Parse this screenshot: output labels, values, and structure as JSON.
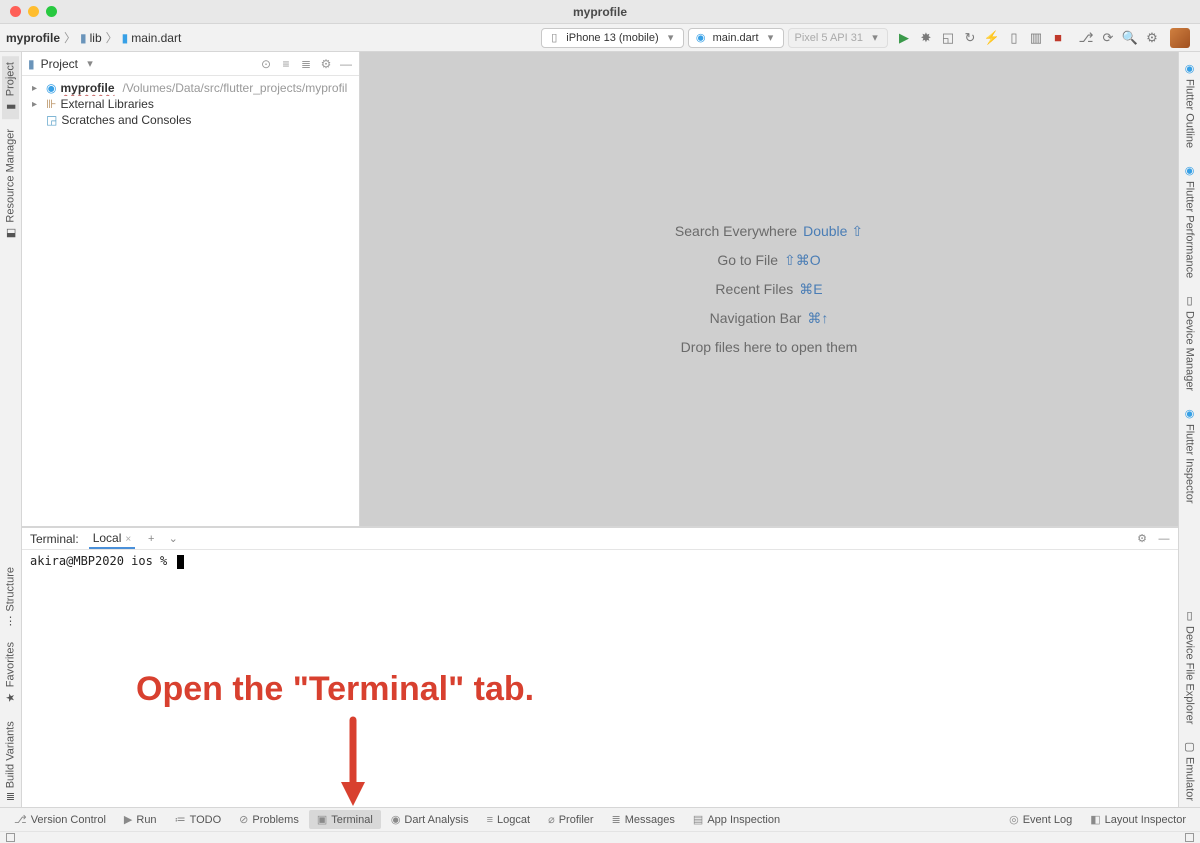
{
  "window": {
    "title": "myprofile"
  },
  "breadcrumb": {
    "items": [
      "myprofile",
      "lib",
      "main.dart"
    ]
  },
  "toolbar": {
    "device": "iPhone 13 (mobile)",
    "run_config": "main.dart",
    "disabled_device": "Pixel 5 API 31"
  },
  "left_gutter": {
    "tabs": [
      "Project",
      "Resource Manager"
    ]
  },
  "right_gutter": {
    "tabs": [
      "Flutter Outline",
      "Flutter Performance",
      "Device Manager",
      "Flutter Inspector"
    ],
    "lower_tabs": [
      "Device File Explorer",
      "Emulator"
    ]
  },
  "project_panel": {
    "header": "Project",
    "root": {
      "name": "myprofile",
      "path": "/Volumes/Data/src/flutter_projects/myprofil"
    },
    "items": [
      {
        "name": "External Libraries"
      },
      {
        "name": "Scratches and Consoles"
      }
    ]
  },
  "editor_hints": [
    {
      "label": "Search Everywhere",
      "keys": "Double ⇧"
    },
    {
      "label": "Go to File",
      "keys": "⇧⌘O"
    },
    {
      "label": "Recent Files",
      "keys": "⌘E"
    },
    {
      "label": "Navigation Bar",
      "keys": "⌘↑"
    },
    {
      "label": "Drop files here to open them",
      "keys": ""
    }
  ],
  "terminal": {
    "header": "Terminal:",
    "tab": "Local",
    "prompt": "akira@MBP2020 ios % "
  },
  "bottom_tabs": {
    "items": [
      "Version Control",
      "Run",
      "TODO",
      "Problems",
      "Terminal",
      "Dart Analysis",
      "Logcat",
      "Profiler",
      "Messages",
      "App Inspection"
    ],
    "right": [
      "Event Log",
      "Layout Inspector"
    ]
  },
  "annotation": {
    "text": "Open the \"Terminal\" tab."
  }
}
